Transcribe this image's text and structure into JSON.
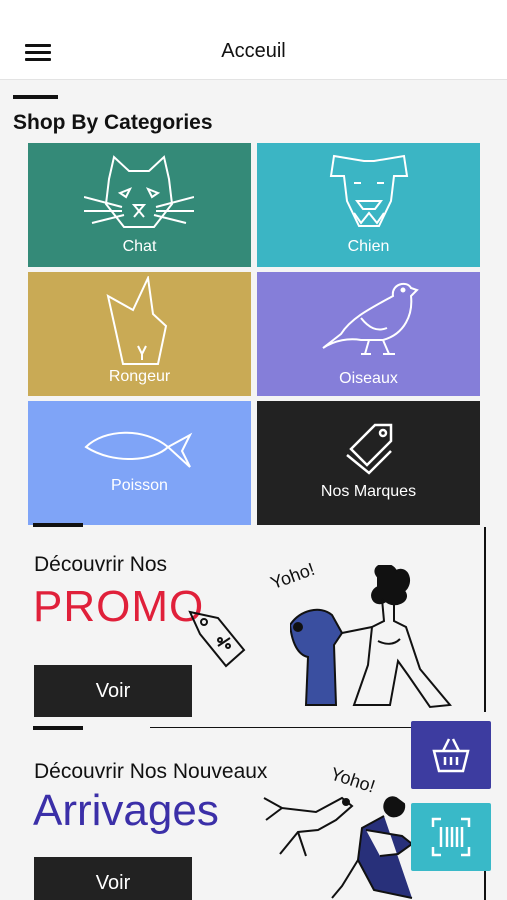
{
  "header": {
    "title": "Acceuil",
    "menu_icon": "hamburger-icon"
  },
  "section": {
    "title": "Shop By Categories"
  },
  "categories": [
    {
      "label": "Chat",
      "color": "#348a78",
      "icon": "cat-icon"
    },
    {
      "label": "Chien",
      "color": "#3bb5c4",
      "icon": "dog-icon"
    },
    {
      "label": "Rongeur",
      "color": "#c9aa55",
      "icon": "rabbit-icon"
    },
    {
      "label": "Oiseaux",
      "color": "#857ed9",
      "icon": "bird-icon"
    },
    {
      "label": "Poisson",
      "color": "#7fa4f7",
      "icon": "fish-icon"
    },
    {
      "label": "Nos Marques",
      "color": "#222222",
      "icon": "tag-icon"
    }
  ],
  "promo": {
    "kicker": "Découvrir Nos",
    "headline": "PROMO",
    "button": "Voir",
    "bubble": "Yoho!",
    "accent": "#e0203a"
  },
  "arrivals": {
    "kicker": "Découvrir Nos Nouveaux",
    "headline": "Arrivages",
    "button": "Voir",
    "bubble": "Yoho!",
    "accent": "#3b2fa8"
  },
  "fabs": [
    {
      "name": "basket",
      "color": "#3d3ca0",
      "icon": "basket-icon"
    },
    {
      "name": "barcode",
      "color": "#39b9c8",
      "icon": "barcode-scan-icon"
    }
  ]
}
